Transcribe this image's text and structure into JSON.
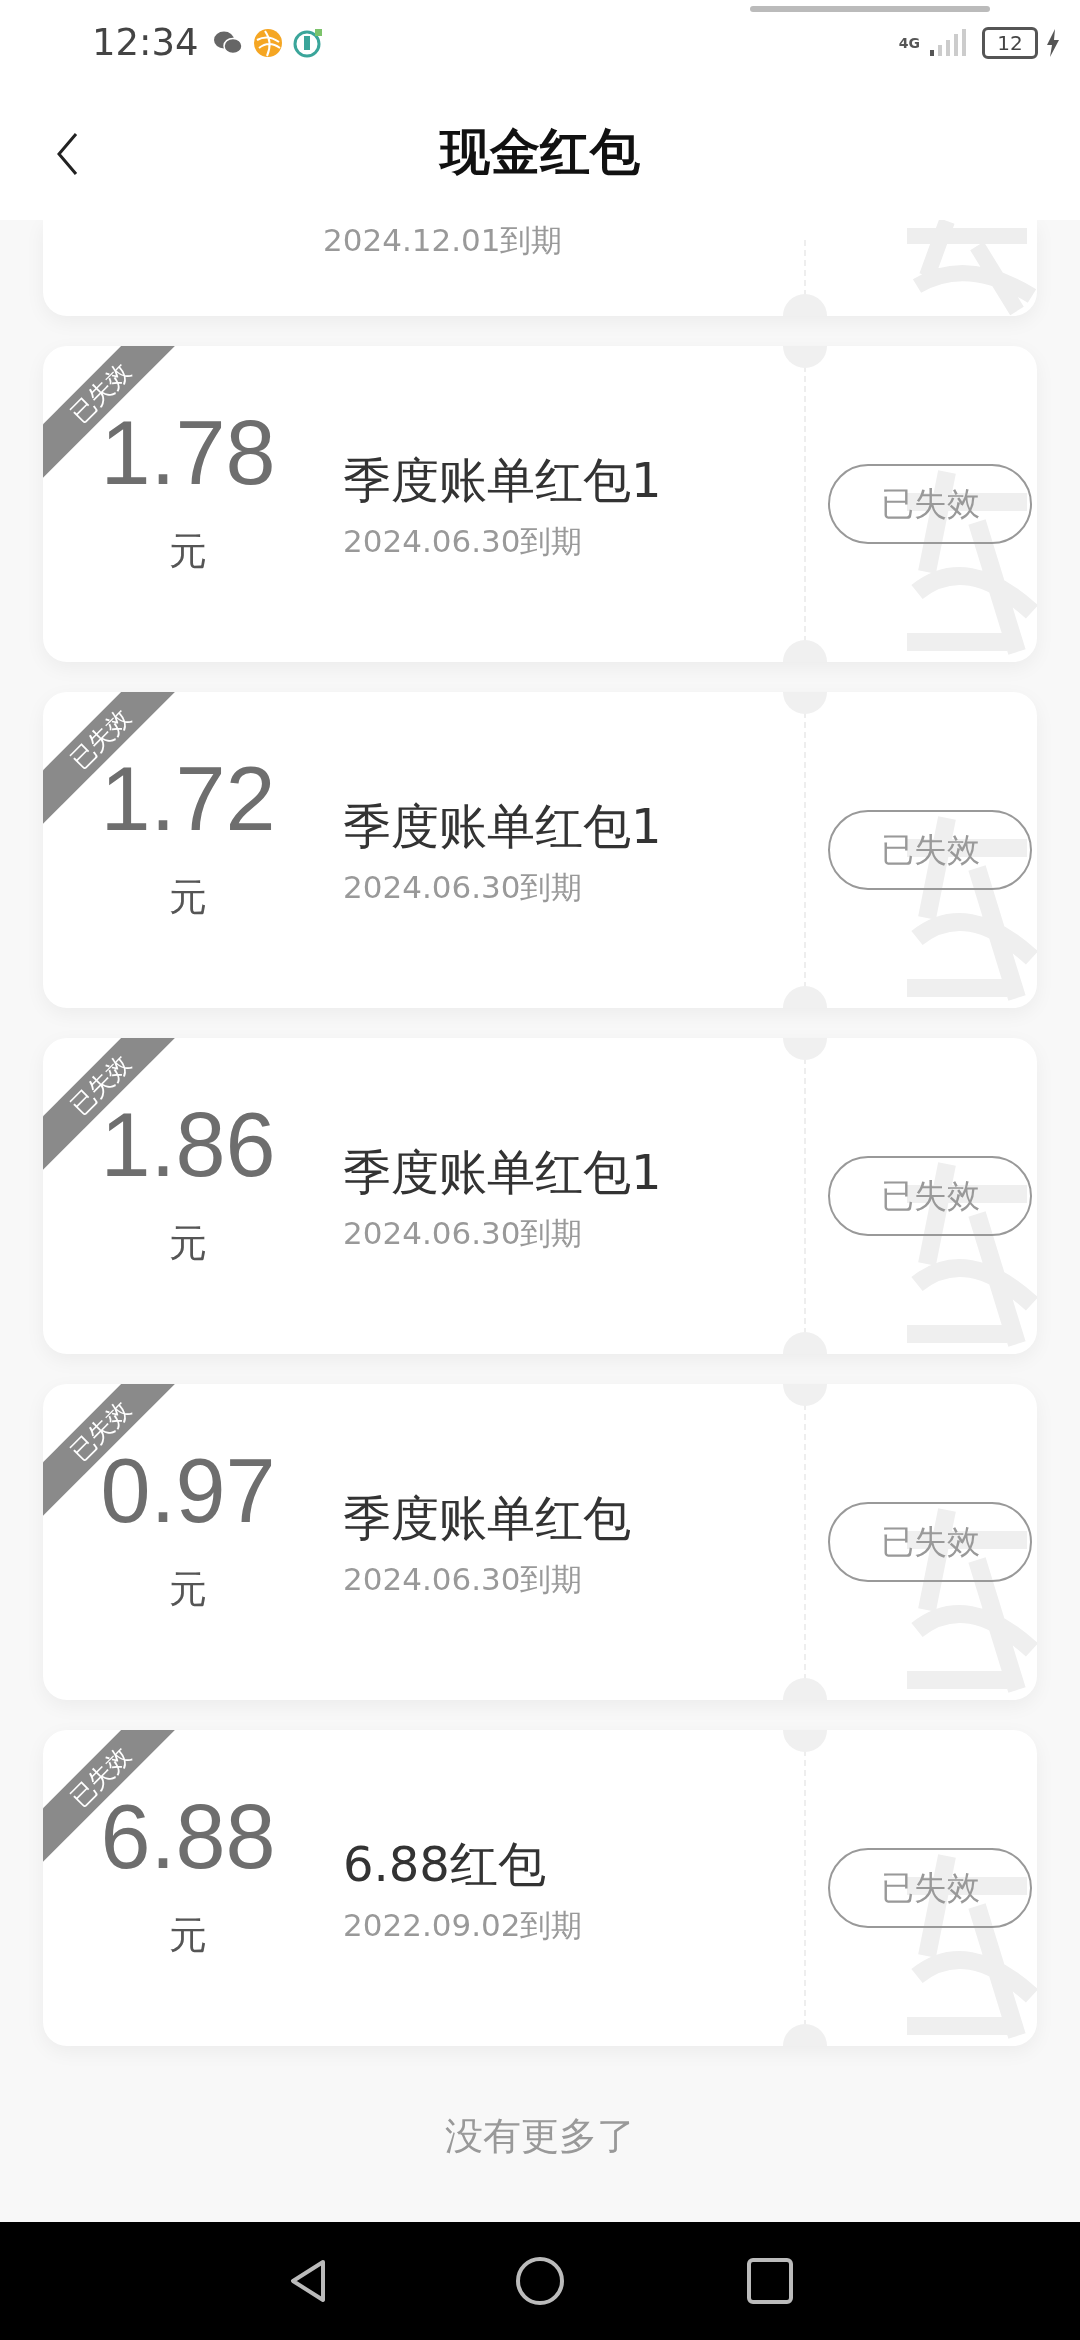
{
  "status_bar": {
    "time": "12:34",
    "network": "4G",
    "battery": "12",
    "charging": true
  },
  "header": {
    "title": "现金红包"
  },
  "partial_card": {
    "date": "2024.12.01到期"
  },
  "cards": [
    {
      "amount": "1.78",
      "unit": "元",
      "title": "季度账单红包1",
      "date": "2024.06.30到期",
      "expired": true,
      "ribbon": "已失效",
      "button": "已失效"
    },
    {
      "amount": "1.72",
      "unit": "元",
      "title": "季度账单红包1",
      "date": "2024.06.30到期",
      "expired": true,
      "ribbon": "已失效",
      "button": "已失效"
    },
    {
      "amount": "1.86",
      "unit": "元",
      "title": "季度账单红包1",
      "date": "2024.06.30到期",
      "expired": true,
      "ribbon": "已失效",
      "button": "已失效"
    },
    {
      "amount": "0.97",
      "unit": "元",
      "title": "季度账单红包",
      "date": "2024.06.30到期",
      "expired": true,
      "ribbon": "已失效",
      "button": "已失效"
    },
    {
      "amount": "6.88",
      "unit": "元",
      "title": "6.88红包",
      "date": "2022.09.02到期",
      "expired": true,
      "ribbon": "已失效",
      "button": "已失效"
    }
  ],
  "footer": "没有更多了"
}
